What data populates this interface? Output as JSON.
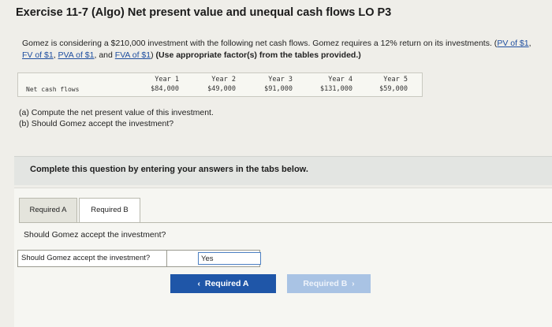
{
  "title": "Exercise 11-7 (Algo) Net present value and unequal cash flows LO P3",
  "intro": {
    "text_before_links": "Gomez is considering a $210,000 investment with the following net cash flows. Gomez requires a 12% return on its investments.",
    "links": [
      "PV of $1",
      "FV of $1",
      "PVA of $1",
      "FVA of $1"
    ],
    "and_word": "and",
    "instruction": "(Use appropriate factor(s) from the tables provided.)"
  },
  "cash_flows": {
    "row_label": "Net cash flows",
    "years": [
      "Year 1",
      "Year 2",
      "Year 3",
      "Year 4",
      "Year 5"
    ],
    "amounts": [
      "$84,000",
      "$49,000",
      "$91,000",
      "$131,000",
      "$59,000"
    ]
  },
  "questions": {
    "a": "(a) Compute the net present value of this investment.",
    "b": "(b) Should Gomez accept the investment?"
  },
  "instructions_band": "Complete this question by entering your answers in the tabs below.",
  "tabs": [
    {
      "label": "Required A",
      "active": false
    },
    {
      "label": "Required B",
      "active": true
    }
  ],
  "panel": {
    "question": "Should Gomez accept the investment?",
    "answer_label": "Should Gomez accept the investment?",
    "answer_value": "Yes"
  },
  "nav": {
    "prev_label": "Required A",
    "next_label": "Required B"
  },
  "colors": {
    "link": "#1f4fa0",
    "nav_primary": "#1f56a8",
    "nav_disabled": "#a9c3e4",
    "input_border": "#4c7fc2"
  }
}
